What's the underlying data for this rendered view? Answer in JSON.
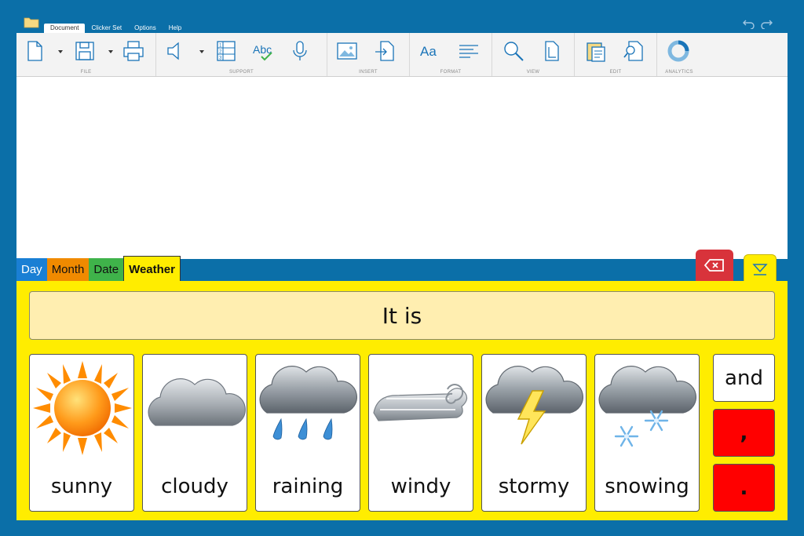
{
  "menu": {
    "tabs": [
      {
        "label": "Document"
      },
      {
        "label": "Clicker Set"
      },
      {
        "label": "Options"
      },
      {
        "label": "Help"
      }
    ],
    "active_tab": "Document"
  },
  "ribbon": {
    "groups": [
      {
        "label": "FILE"
      },
      {
        "label": "SUPPORT"
      },
      {
        "label": "INSERT"
      },
      {
        "label": "FORMAT"
      },
      {
        "label": "VIEW"
      },
      {
        "label": "EDIT"
      },
      {
        "label": "ANALYTICS"
      }
    ],
    "icons": [
      "new-document-icon",
      "save-icon",
      "print-icon",
      "speaker-icon",
      "word-list-icon",
      "spellcheck-icon",
      "microphone-icon",
      "insert-image-icon",
      "insert-file-icon",
      "font-icon",
      "align-icon",
      "zoom-icon",
      "page-size-icon",
      "paste-icon",
      "find-icon",
      "analytics-icon"
    ]
  },
  "set_tabs": [
    {
      "label": "Day",
      "color": "#1a7fd4"
    },
    {
      "label": "Month",
      "color": "#f08a00"
    },
    {
      "label": "Date",
      "color": "#3fb34a"
    },
    {
      "label": "Weather",
      "color": "#ffed00"
    }
  ],
  "active_set_tab": "Weather",
  "grid": {
    "sentence": "It is",
    "cells": [
      {
        "label": "sunny",
        "icon": "sun-icon"
      },
      {
        "label": "cloudy",
        "icon": "cloud-icon"
      },
      {
        "label": "raining",
        "icon": "rain-cloud-icon"
      },
      {
        "label": "windy",
        "icon": "wind-icon"
      },
      {
        "label": "stormy",
        "icon": "storm-cloud-icon"
      },
      {
        "label": "snowing",
        "icon": "snow-cloud-icon"
      }
    ],
    "side": [
      {
        "label": "and",
        "color": "#ffffff"
      },
      {
        "label": ",",
        "color": "#ff0000"
      },
      {
        "label": ".",
        "color": "#ff0000"
      }
    ]
  },
  "colors": {
    "background": "#0b6fa8",
    "panel": "#ffed00",
    "sentence_bg": "#ffeeb0",
    "delete": "#d8333b"
  }
}
